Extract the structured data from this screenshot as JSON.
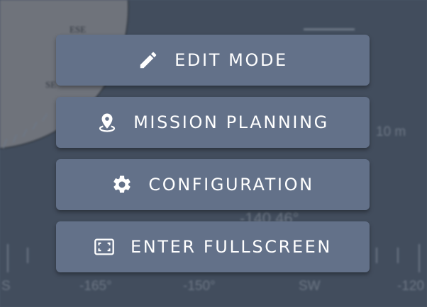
{
  "menu": {
    "items": [
      {
        "label": "EDIT MODE",
        "icon": "pencil-icon"
      },
      {
        "label": "MISSION PLANNING",
        "icon": "map-pin-icon"
      },
      {
        "label": "CONFIGURATION",
        "icon": "gear-icon"
      },
      {
        "label": "ENTER FULLSCREEN",
        "icon": "fullscreen-icon"
      }
    ]
  },
  "background": {
    "compass_labels": [
      "ESE",
      "SE"
    ],
    "distance": "10 m",
    "heading": "-140.46°",
    "heading_scale": [
      "S",
      "-165°",
      "-150°",
      "SW",
      "-120"
    ]
  },
  "colors": {
    "button_bg": "#637189",
    "button_text": "#ffffff",
    "backdrop": "#4a5566"
  }
}
